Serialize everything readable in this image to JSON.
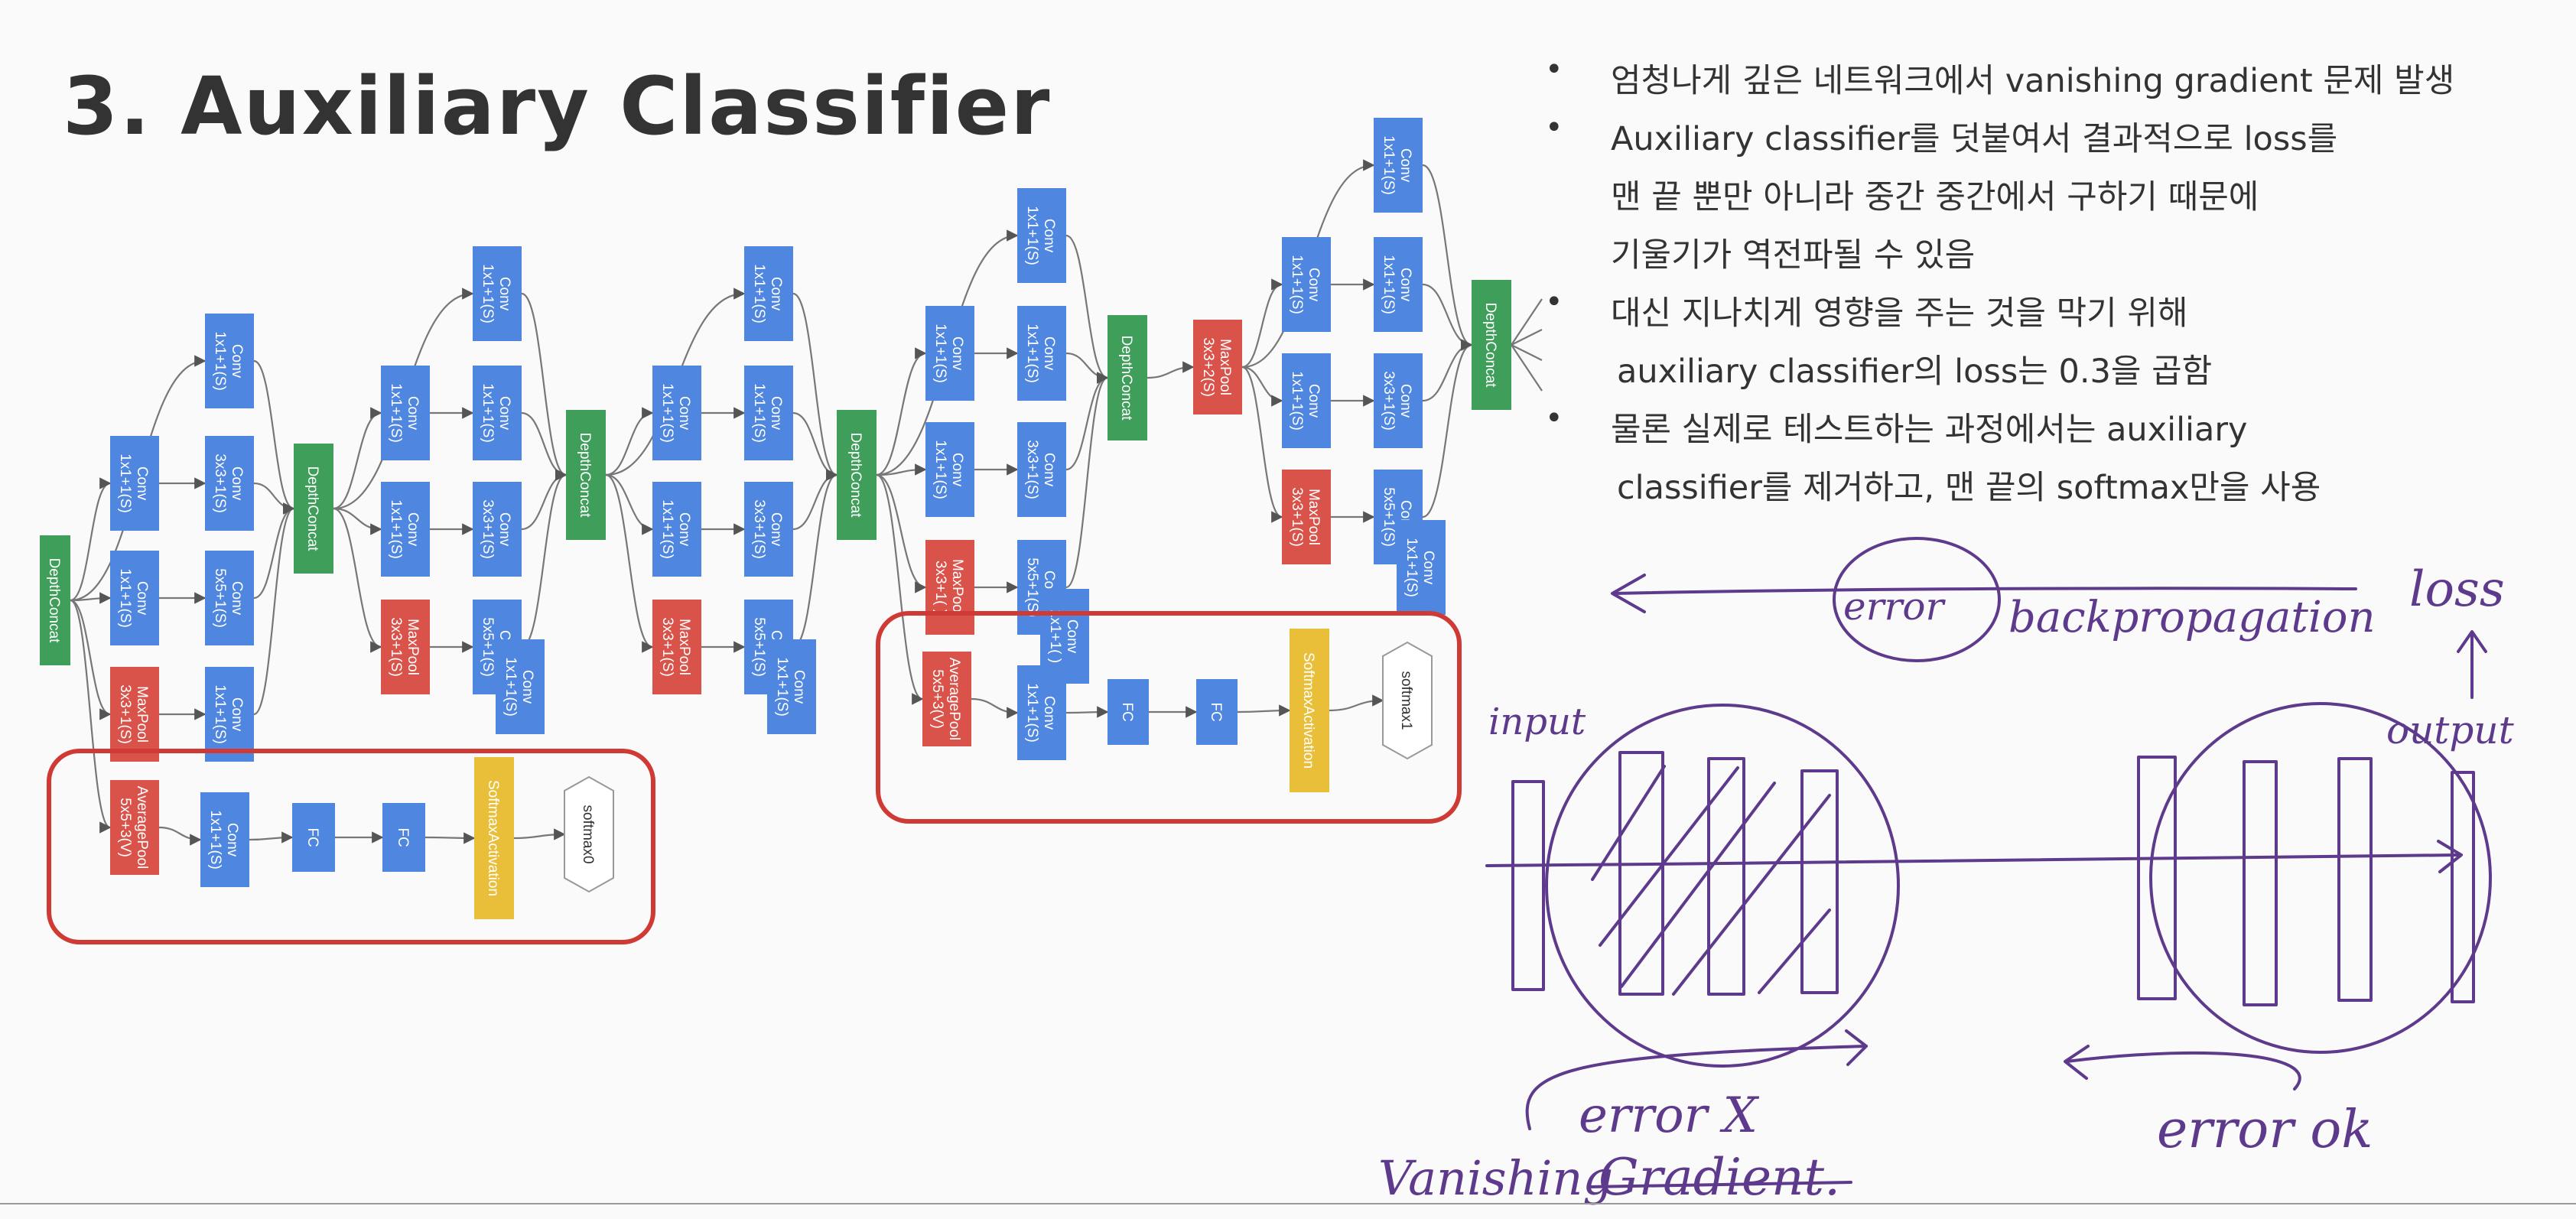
{
  "slide": {
    "title": "3. Auxiliary Classifier",
    "bullets": [
      {
        "lines": [
          "엄청나게 깊은 네트워크에서 vanishing gradient 문제 발생"
        ]
      },
      {
        "lines": [
          "Auxiliary classifier를 덧붙여서 결과적으로 loss를",
          "맨 끝 뿐만 아니라 중간 중간에서 구하기 때문에",
          "기울기가 역전파될 수 있음"
        ]
      },
      {
        "lines": [
          "대신 지나치게 영향을 주는 것을 막기 위해",
          "auxiliary classifier의 loss는 0.3을 곱함"
        ]
      },
      {
        "lines": [
          "물론 실제로 테스트하는 과정에서는 auxiliary",
          "classifier를 제거하고, 맨 끝의 softmax만을 사용"
        ]
      }
    ]
  },
  "diagram": {
    "colors": {
      "conv": "#4f86e0",
      "pool": "#d9534a",
      "concat": "#3f9e5a",
      "softmax_act": "#e9bf3a",
      "highlight": "#cf3a34",
      "ink": "#5e3a8c",
      "edge": "#777777"
    },
    "nodes": [
      {
        "id": "dc0",
        "kind": "concat",
        "lines": [
          "DepthConcat"
        ]
      },
      {
        "id": "a1",
        "kind": "conv",
        "lines": [
          "Conv",
          "1x1+1(S)"
        ]
      },
      {
        "id": "a2",
        "kind": "conv",
        "lines": [
          "Conv",
          "1x1+1(S)"
        ]
      },
      {
        "id": "a3",
        "kind": "conv",
        "lines": [
          "Conv",
          "1x1+1(S)"
        ]
      },
      {
        "id": "a4",
        "kind": "pool",
        "lines": [
          "MaxPool",
          "3x3+1(S)"
        ]
      },
      {
        "id": "a5",
        "kind": "conv",
        "lines": [
          "Conv",
          "3x3+1(S)"
        ]
      },
      {
        "id": "a6",
        "kind": "conv",
        "lines": [
          "Conv",
          "5x5+1(S)"
        ]
      },
      {
        "id": "a7",
        "kind": "conv",
        "lines": [
          "Conv",
          "1x1+1(S)"
        ]
      },
      {
        "id": "dc1",
        "kind": "concat",
        "lines": [
          "DepthConcat"
        ]
      },
      {
        "id": "b1",
        "kind": "conv",
        "lines": [
          "Conv",
          "1x1+1(S)"
        ]
      },
      {
        "id": "b2",
        "kind": "conv",
        "lines": [
          "Conv",
          "1x1+1(S)"
        ]
      },
      {
        "id": "b3",
        "kind": "conv",
        "lines": [
          "Conv",
          "1x1+1(S)"
        ]
      },
      {
        "id": "b4",
        "kind": "pool",
        "lines": [
          "MaxPool",
          "3x3+1(S)"
        ]
      },
      {
        "id": "b5",
        "kind": "conv",
        "lines": [
          "Conv",
          "1x1+1(S)"
        ]
      },
      {
        "id": "b6",
        "kind": "conv",
        "lines": [
          "Conv",
          "3x3+1(S)"
        ]
      },
      {
        "id": "b7",
        "kind": "conv",
        "lines": [
          "Conv",
          "5x5+1(S)"
        ]
      },
      {
        "id": "b8",
        "kind": "conv",
        "lines": [
          "Conv",
          "1x1+1(S)"
        ]
      },
      {
        "id": "dc2",
        "kind": "concat",
        "lines": [
          "DepthConcat"
        ]
      },
      {
        "id": "c1",
        "kind": "conv",
        "lines": [
          "Conv",
          "1x1+1(S)"
        ]
      },
      {
        "id": "c2",
        "kind": "conv",
        "lines": [
          "Conv",
          "1x1+1(S)"
        ]
      },
      {
        "id": "c3",
        "kind": "conv",
        "lines": [
          "Conv",
          "1x1+1(S)"
        ]
      },
      {
        "id": "c4",
        "kind": "pool",
        "lines": [
          "MaxPool",
          "3x3+1(S)"
        ]
      },
      {
        "id": "c5",
        "kind": "conv",
        "lines": [
          "Conv",
          "1x1+1(S)"
        ]
      },
      {
        "id": "c6",
        "kind": "conv",
        "lines": [
          "Conv",
          "3x3+1(S)"
        ]
      },
      {
        "id": "c7",
        "kind": "conv",
        "lines": [
          "Conv",
          "5x5+1(S)"
        ]
      },
      {
        "id": "c8",
        "kind": "conv",
        "lines": [
          "Conv",
          "1x1+1(S)"
        ]
      },
      {
        "id": "dc3",
        "kind": "concat",
        "lines": [
          "DepthConcat"
        ]
      },
      {
        "id": "d1",
        "kind": "conv",
        "lines": [
          "Conv",
          "1x1+1(S)"
        ]
      },
      {
        "id": "d2",
        "kind": "conv",
        "lines": [
          "Conv",
          "1x1+1(S)"
        ]
      },
      {
        "id": "d3",
        "kind": "conv",
        "lines": [
          "Conv",
          "1x1+1(S)"
        ]
      },
      {
        "id": "d4",
        "kind": "pool",
        "lines": [
          "MaxPool",
          "3x3+1( )"
        ]
      },
      {
        "id": "d5",
        "kind": "conv",
        "lines": [
          "Conv",
          "1x1+1(S)"
        ]
      },
      {
        "id": "d6",
        "kind": "conv",
        "lines": [
          "Conv",
          "3x3+1(S)"
        ]
      },
      {
        "id": "d7",
        "kind": "conv",
        "lines": [
          "Conv",
          "5x5+1(S)"
        ]
      },
      {
        "id": "d8",
        "kind": "conv",
        "lines": [
          "Conv",
          "1x1+1( )"
        ]
      },
      {
        "id": "dc4",
        "kind": "concat",
        "lines": [
          "DepthConcat"
        ]
      },
      {
        "id": "mp",
        "kind": "pool",
        "lines": [
          "MaxPool",
          "3x3+2(S)"
        ]
      },
      {
        "id": "e1",
        "kind": "conv",
        "lines": [
          "Conv",
          "1x1+1(S)"
        ]
      },
      {
        "id": "e2",
        "kind": "conv",
        "lines": [
          "Conv",
          "1x1+1(S)"
        ]
      },
      {
        "id": "e3",
        "kind": "conv",
        "lines": [
          "Conv",
          "1x1+1(S)"
        ]
      },
      {
        "id": "e4",
        "kind": "pool",
        "lines": [
          "MaxPool",
          "3x3+1(S)"
        ]
      },
      {
        "id": "e5",
        "kind": "conv",
        "lines": [
          "Conv",
          "1x1+1(S)"
        ]
      },
      {
        "id": "e6",
        "kind": "conv",
        "lines": [
          "Conv",
          "3x3+1(S)"
        ]
      },
      {
        "id": "e7",
        "kind": "conv",
        "lines": [
          "Conv",
          "5x5+1(S)"
        ]
      },
      {
        "id": "e8",
        "kind": "conv",
        "lines": [
          "Conv",
          "1x1+1(S)"
        ]
      },
      {
        "id": "dc5",
        "kind": "concat",
        "lines": [
          "DepthConcat"
        ]
      },
      {
        "id": "x0p",
        "kind": "pool",
        "lines": [
          "AveragePool",
          "5x5+3(V)"
        ]
      },
      {
        "id": "x0c",
        "kind": "conv",
        "lines": [
          "Conv",
          "1x1+1(S)"
        ]
      },
      {
        "id": "x0f1",
        "kind": "conv",
        "lines": [
          "FC"
        ]
      },
      {
        "id": "x0f2",
        "kind": "conv",
        "lines": [
          "FC"
        ]
      },
      {
        "id": "x0s",
        "kind": "softmax_act",
        "lines": [
          "SoftmaxActivation"
        ]
      },
      {
        "id": "x0o",
        "kind": "output",
        "lines": [
          "softmax0"
        ]
      },
      {
        "id": "x1p",
        "kind": "pool",
        "lines": [
          "AveragePool",
          "5x5+3(V)"
        ]
      },
      {
        "id": "x1c",
        "kind": "conv",
        "lines": [
          "Conv",
          "1x1+1(S)"
        ]
      },
      {
        "id": "x1f1",
        "kind": "conv",
        "lines": [
          "FC"
        ]
      },
      {
        "id": "x1f2",
        "kind": "conv",
        "lines": [
          "FC"
        ]
      },
      {
        "id": "x1s",
        "kind": "softmax_act",
        "lines": [
          "SoftmaxActivation"
        ]
      },
      {
        "id": "x1o",
        "kind": "output",
        "lines": [
          "softmax1"
        ]
      }
    ],
    "handwriting": {
      "error_word": "error",
      "backprop": "backpropagation",
      "loss": "loss",
      "input": "input",
      "output": "output",
      "error_x": "error X",
      "vanishing": "Vanishing",
      "gradient": "Gradient.",
      "error_ok": "error ok"
    }
  }
}
